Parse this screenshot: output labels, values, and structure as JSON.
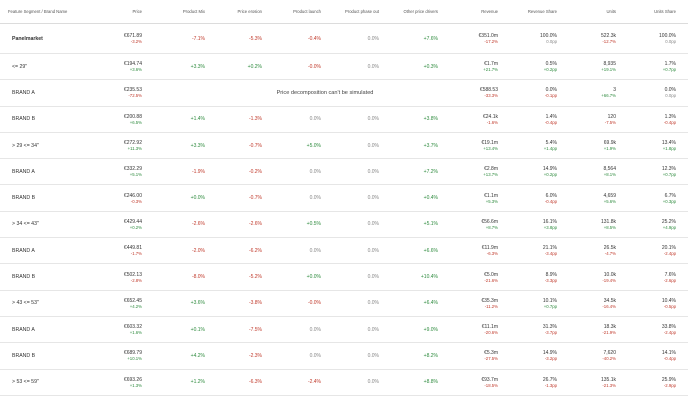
{
  "headers": {
    "name": "Feature Segment / Brand Name",
    "price": "Price",
    "product_mix": "Product Mix",
    "price_erosion": "Price erosion",
    "product_launch": "Product launch",
    "product_phase_out": "Product phase out",
    "other_drivers": "Other price drivers",
    "revenue": "Revenue",
    "revenue_share": "Revenue Share",
    "units": "Units",
    "units_share": "Units Share"
  },
  "rows": [
    {
      "type": "segment",
      "name": "Panelmarket",
      "price": "€671.89",
      "price_sub": "-3.2%",
      "mix": "-7.1%",
      "mix_c": "neg",
      "erosion": "-5.3%",
      "erosion_c": "neg",
      "launch": "-0.4%",
      "launch_c": "neg",
      "phase": "0.0%",
      "phase_c": "neu",
      "other": "+7.6%",
      "other_c": "pos",
      "revenue": "€351.0m",
      "revenue_sub": "-17.2%",
      "rshare": "100.0%",
      "rshare_sub": "0.0pp",
      "units": "522.3k",
      "units_sub": "-12.7%",
      "ushare": "100.0%",
      "ushare_sub": "0.0pp"
    },
    {
      "type": "segment",
      "name": "<= 29\"",
      "price": "€194.74",
      "price_sub": "+3.6%",
      "mix": "+3.3%",
      "mix_c": "pos",
      "erosion": "+0.2%",
      "erosion_c": "pos",
      "launch": "-0.0%",
      "launch_c": "neg",
      "phase": "0.0%",
      "phase_c": "neu",
      "other": "+0.3%",
      "other_c": "pos",
      "revenue": "€1.7m",
      "revenue_sub": "+21.7%",
      "rshare": "0.5%",
      "rshare_sub": "+0.2pp",
      "units": "8,935",
      "units_sub": "+19.1%",
      "ushare": "1.7%",
      "ushare_sub": "+0.7pp"
    },
    {
      "type": "brand",
      "name": "BRAND A",
      "price": "€235.53",
      "price_sub": "-72.5%",
      "msg": "Price decomposition can't be simulated",
      "revenue": "€588.53",
      "revenue_sub": "-33.3%",
      "rshare": "0.0%",
      "rshare_sub": "-0.1pp",
      "units": "3",
      "units_sub": "+66.7%",
      "ushare": "0.0%",
      "ushare_sub": "0.0pp"
    },
    {
      "type": "brand",
      "name": "BRAND B",
      "price": "€200.88",
      "price_sub": "+6.5%",
      "mix": "+1.4%",
      "mix_c": "pos",
      "erosion": "-1.3%",
      "erosion_c": "neg",
      "launch": "0.0%",
      "launch_c": "neu",
      "phase": "0.0%",
      "phase_c": "neu",
      "other": "+3.8%",
      "other_c": "pos",
      "revenue": "€24.1k",
      "revenue_sub": "-1.6%",
      "rshare": "1.4%",
      "rshare_sub": "-0.4pp",
      "units": "120",
      "units_sub": "-7.5%",
      "ushare": "1.3%",
      "ushare_sub": "-0.4pp"
    },
    {
      "type": "segment",
      "name": "> 29 <= 34\"",
      "price": "€272.92",
      "price_sub": "+11.3%",
      "mix": "+3.3%",
      "mix_c": "pos",
      "erosion": "-0.7%",
      "erosion_c": "neg",
      "launch": "+5.0%",
      "launch_c": "pos",
      "phase": "0.0%",
      "phase_c": "neu",
      "other": "+3.7%",
      "other_c": "pos",
      "revenue": "€19.1m",
      "revenue_sub": "+13.4%",
      "rshare": "5.4%",
      "rshare_sub": "+1.4pp",
      "units": "69.9k",
      "units_sub": "+1.9%",
      "ushare": "13.4%",
      "ushare_sub": "+1.8pp"
    },
    {
      "type": "brand",
      "name": "BRAND A",
      "price": "€332.29",
      "price_sub": "+5.1%",
      "mix": "-1.9%",
      "mix_c": "neg",
      "erosion": "-0.2%",
      "erosion_c": "neg",
      "launch": "0.0%",
      "launch_c": "neu",
      "phase": "0.0%",
      "phase_c": "neu",
      "other": "+7.2%",
      "other_c": "pos",
      "revenue": "€2.8m",
      "revenue_sub": "+13.7%",
      "rshare": "14.9%",
      "rshare_sub": "+0.2pp",
      "units": "8,564",
      "units_sub": "+8.1%",
      "ushare": "12.3%",
      "ushare_sub": "+0.7pp"
    },
    {
      "type": "brand",
      "name": "BRAND B",
      "price": "€246.00",
      "price_sub": "-0.3%",
      "mix": "+0.0%",
      "mix_c": "pos",
      "erosion": "-0.7%",
      "erosion_c": "neg",
      "launch": "0.0%",
      "launch_c": "neu",
      "phase": "0.0%",
      "phase_c": "neu",
      "other": "+0.4%",
      "other_c": "pos",
      "revenue": "€1.1m",
      "revenue_sub": "+5.3%",
      "rshare": "6.0%",
      "rshare_sub": "-0.4pp",
      "units": "4,659",
      "units_sub": "+5.6%",
      "ushare": "6.7%",
      "ushare_sub": "+0.3pp"
    },
    {
      "type": "segment",
      "name": "> 34 <= 43\"",
      "price": "€429.44",
      "price_sub": "+0.2%",
      "mix": "-2.6%",
      "mix_c": "neg",
      "erosion": "-2.6%",
      "erosion_c": "neg",
      "launch": "+0.5%",
      "launch_c": "pos",
      "phase": "0.0%",
      "phase_c": "neu",
      "other": "+5.1%",
      "other_c": "pos",
      "revenue": "€56.6m",
      "revenue_sub": "+8.7%",
      "rshare": "16.1%",
      "rshare_sub": "+3.8pp",
      "units": "131.8k",
      "units_sub": "+8.5%",
      "ushare": "25.2%",
      "ushare_sub": "+4.9pp"
    },
    {
      "type": "brand",
      "name": "BRAND A",
      "price": "€449.81",
      "price_sub": "-1.7%",
      "mix": "-2.0%",
      "mix_c": "neg",
      "erosion": "-6.2%",
      "erosion_c": "neg",
      "launch": "0.0%",
      "launch_c": "neu",
      "phase": "0.0%",
      "phase_c": "neu",
      "other": "+6.6%",
      "other_c": "pos",
      "revenue": "€11.9m",
      "revenue_sub": "-6.3%",
      "rshare": "21.1%",
      "rshare_sub": "-3.4pp",
      "units": "26.5k",
      "units_sub": "-4.7%",
      "ushare": "20.1%",
      "ushare_sub": "-2.4pp"
    },
    {
      "type": "brand",
      "name": "BRAND B",
      "price": "€502.13",
      "price_sub": "-2.8%",
      "mix": "-8.0%",
      "mix_c": "neg",
      "erosion": "-5.2%",
      "erosion_c": "neg",
      "launch": "+0.0%",
      "launch_c": "pos",
      "phase": "0.0%",
      "phase_c": "neu",
      "other": "+10.4%",
      "other_c": "pos",
      "revenue": "€5.0m",
      "revenue_sub": "-21.6%",
      "rshare": "8.9%",
      "rshare_sub": "-3.3pp",
      "units": "10.0k",
      "units_sub": "-19.4%",
      "ushare": "7.6%",
      "ushare_sub": "-2.6pp"
    },
    {
      "type": "segment",
      "name": "> 43 <= 53\"",
      "price": "€652.45",
      "price_sub": "+4.2%",
      "mix": "+3.6%",
      "mix_c": "pos",
      "erosion": "-3.8%",
      "erosion_c": "neg",
      "launch": "-0.0%",
      "launch_c": "neg",
      "phase": "0.0%",
      "phase_c": "neu",
      "other": "+6.4%",
      "other_c": "pos",
      "revenue": "€35.3m",
      "revenue_sub": "-11.2%",
      "rshare": "10.1%",
      "rshare_sub": "+0.7pp",
      "units": "34.5k",
      "units_sub": "-16.4%",
      "ushare": "10.4%",
      "ushare_sub": "-0.5pp"
    },
    {
      "type": "brand",
      "name": "BRAND A",
      "price": "€603.32",
      "price_sub": "+1.6%",
      "mix": "+0.1%",
      "mix_c": "pos",
      "erosion": "-7.5%",
      "erosion_c": "neg",
      "launch": "0.0%",
      "launch_c": "neu",
      "phase": "0.0%",
      "phase_c": "neu",
      "other": "+9.0%",
      "other_c": "pos",
      "revenue": "€11.1m",
      "revenue_sub": "-20.6%",
      "rshare": "31.3%",
      "rshare_sub": "-3.7pp",
      "units": "18.3k",
      "units_sub": "-21.9%",
      "ushare": "33.8%",
      "ushare_sub": "-2.4pp"
    },
    {
      "type": "brand",
      "name": "BRAND B",
      "price": "€689.79",
      "price_sub": "+10.1%",
      "mix": "+4.2%",
      "mix_c": "pos",
      "erosion": "-2.3%",
      "erosion_c": "neg",
      "launch": "0.0%",
      "launch_c": "neu",
      "phase": "0.0%",
      "phase_c": "neu",
      "other": "+8.2%",
      "other_c": "pos",
      "revenue": "€5.3m",
      "revenue_sub": "-27.5%",
      "rshare": "14.9%",
      "rshare_sub": "-3.2pp",
      "units": "7,620",
      "units_sub": "-40.2%",
      "ushare": "14.1%",
      "ushare_sub": "-0.4pp"
    },
    {
      "type": "segment",
      "name": "> 53 <= 59\"",
      "price": "€693.26",
      "price_sub": "+1.3%",
      "mix": "+1.2%",
      "mix_c": "pos",
      "erosion": "-6.3%",
      "erosion_c": "neg",
      "launch": "-2.4%",
      "launch_c": "neg",
      "phase": "0.0%",
      "phase_c": "neu",
      "other": "+8.8%",
      "other_c": "pos",
      "revenue": "€93.7m",
      "revenue_sub": "-18.5%",
      "rshare": "26.7%",
      "rshare_sub": "-1.3pp",
      "units": "135.1k",
      "units_sub": "-21.3%",
      "ushare": "25.9%",
      "ushare_sub": "-2.9pp"
    }
  ]
}
